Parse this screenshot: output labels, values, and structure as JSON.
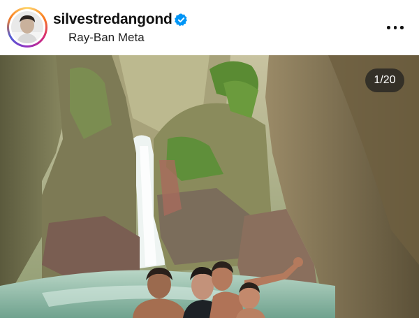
{
  "post": {
    "username": "silvestredangond",
    "location": "Ray-Ban Meta",
    "verified": true,
    "media_counter": "1/20"
  },
  "icons": {
    "verified": "verified-badge-icon",
    "more": "more-options-icon"
  },
  "colors": {
    "verified_blue": "#0095f6",
    "text": "#111111"
  }
}
